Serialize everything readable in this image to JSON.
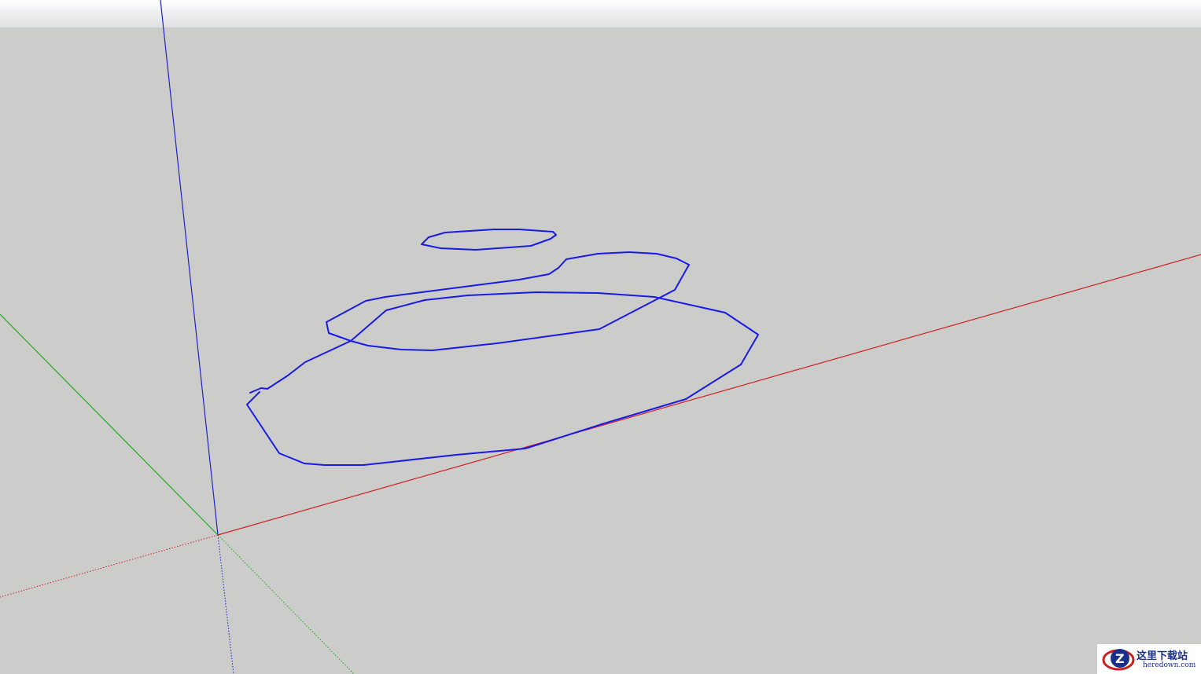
{
  "app": {
    "view": "3D modeling viewport"
  },
  "scene": {
    "background_color": "#cccccb",
    "sky_color": "#e6e8ea",
    "axes": {
      "red_axis_color": "#cc2222",
      "green_axis_color": "#22aa22",
      "blue_axis_color": "#2222cc"
    },
    "drawing": {
      "stroke_color": "#1a1ae6",
      "description_name": "freehand-spiral"
    }
  },
  "watermark": {
    "title": "这里下载站",
    "url": "heredown.com",
    "brand_color": "#1a2f8a",
    "accent_color": "#cc1f1f"
  }
}
